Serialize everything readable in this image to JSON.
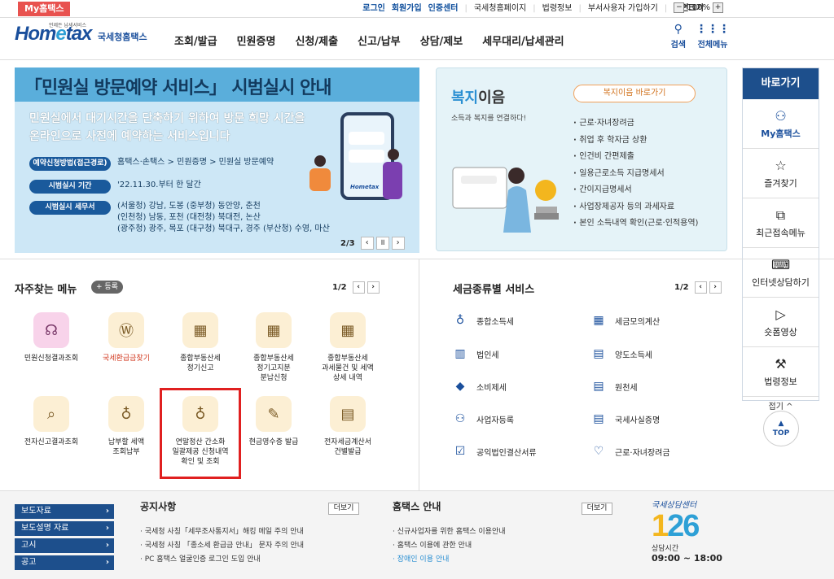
{
  "topbar": {
    "my_home": "My홈택스",
    "links": [
      "로그인",
      "회원가입",
      "인증센터",
      "국세청홈페이지",
      "법령정보",
      "부서사용자 가입하기",
      "화면크기"
    ],
    "zoom": "100%"
  },
  "header": {
    "logo_text": "Hometax",
    "logo_sub": "국세청홈택스",
    "logo_tiny": "언제든 납세서비스",
    "menu": [
      "조회/발급",
      "민원증명",
      "신청/제출",
      "신고/납부",
      "상담/제보",
      "세무대리/납세관리"
    ],
    "search": "검색",
    "all_menu": "전체메뉴"
  },
  "banner1": {
    "title": "「민원실 방문예약 서비스」 시범실시 안내",
    "desc1": "민원실에서 대기시간을 단축하기 위하여 방문 희망 시간을",
    "desc2": "온라인으로 사전에 예약하는 서비스입니다",
    "rows": [
      {
        "label": "예약신청방법(접근경로)",
        "value": "홈택스·손택스 > 민원증명 > 민원실 방문예약"
      },
      {
        "label": "시범실시 기간",
        "value": "'22.11.30.부터 한 달간"
      },
      {
        "label": "시범실시 세무서",
        "value1": "(서울청) 강남, 도봉 (중부청) 동안양, 춘천",
        "value2": "(인천청) 남동, 포천 (대전청) 북대전, 논산",
        "value3": "(광주청) 광주, 목포 (대구청) 북대구, 경주 (부산청) 수영, 마산"
      }
    ],
    "page": "2/3",
    "phone_logo": "Hometax"
  },
  "banner2": {
    "title_a": "복지",
    "title_b": "이음",
    "sub": "소득과 복지를 연결하다!",
    "button": "복지이음 바로가기",
    "items": [
      "근로·자녀장려금",
      "취업 후 학자금 상환",
      "인건비 간편제출",
      "일용근로소득 지급명세서",
      "간이지급명세서",
      "사업장제공자 등의 과세자료",
      "본인 소득내역 확인(근로·인적용역)"
    ]
  },
  "rightbar": {
    "title": "바로가기",
    "items": [
      "My홈택스",
      "즐겨찾기",
      "최근접속메뉴",
      "인터넷상담하기",
      "숏폼영상",
      "법령정보"
    ],
    "fold": "접기 ^",
    "top": "TOP"
  },
  "favorites": {
    "title": "자주찾는 메뉴",
    "add": "+ 등록",
    "page": "1/2",
    "items": [
      {
        "l1": "민원신청결과조회",
        "l2": ""
      },
      {
        "l1": "국세환급금찾기",
        "l2": ""
      },
      {
        "l1": "종합부동산세",
        "l2": "정기신고"
      },
      {
        "l1": "종합부동산세",
        "l2": "정기고지분",
        "l3": "분납신청"
      },
      {
        "l1": "종합부동산세",
        "l2": "과세물건 및 세액",
        "l3": "상세 내역"
      },
      {
        "l1": "전자신고결과조회",
        "l2": ""
      },
      {
        "l1": "납부할 세액",
        "l2": "조회납부"
      },
      {
        "l1": "연말정산 간소화",
        "l2": "일괄제공 신청내역",
        "l3": "확인 및 조회"
      },
      {
        "l1": "현금영수증 발급",
        "l2": ""
      },
      {
        "l1": "전자세금계산서",
        "l2": "건별발급"
      }
    ]
  },
  "tax_services": {
    "title": "세금종류별 서비스",
    "page": "1/2",
    "items": [
      "종합소득세",
      "세금모의계산",
      "법인세",
      "양도소득세",
      "소비제세",
      "원천세",
      "사업자등록",
      "국세사실증명",
      "공익법인결산서류",
      "근로·자녀장려금"
    ]
  },
  "footer": {
    "links": [
      "보도자료",
      "보도설명 자료",
      "고시",
      "공고"
    ],
    "notice_title": "공지사항",
    "notice_more": "더보기",
    "notices": [
      "국세청 사칭「세무조사통지서」해킹 메일 주의 안내",
      "국세청 사칭 「종소세 환급금 안내」 문자 주의 안내",
      "PC 홈택스 얼굴인증 로그인 도입 안내"
    ],
    "guide_title": "홈택스 안내",
    "guide_more": "더보기",
    "guides": [
      "신규사업자를 위한 홈택스 이용안내",
      "홈택스 이용에 관한 안내",
      "장애인 이용 안내"
    ],
    "cc_title": "국세상담센터",
    "cc_num_a": "1",
    "cc_num_b": "26",
    "cc_hours_label": "상담시간",
    "cc_hours": "09:00 ~ 18:00"
  }
}
